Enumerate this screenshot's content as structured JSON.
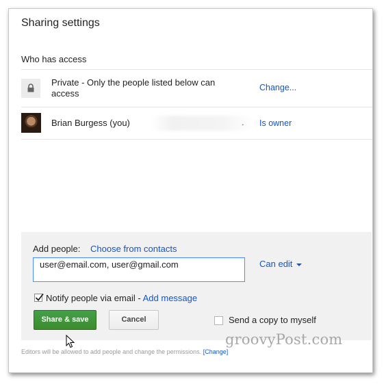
{
  "dialog": {
    "title": "Sharing settings",
    "who_has_access_label": "Who has access"
  },
  "access_rows": [
    {
      "icon": "lock-icon",
      "text": "Private - Only the people listed below can access",
      "action": "Change..."
    },
    {
      "icon": "avatar",
      "text": "Brian Burgess (you)",
      "trailing": ".",
      "action": "Is owner"
    }
  ],
  "add_people": {
    "label": "Add people:",
    "choose_link": "Choose from contacts",
    "input_value": "user@email.com, user@gmail.com",
    "permission": "Can edit",
    "notify_label": "Notify people via email - ",
    "notify_checked": true,
    "add_message_link": "Add message",
    "share_button": "Share & save",
    "cancel_button": "Cancel",
    "copy_label": "Send a copy to myself",
    "copy_checked": false
  },
  "footer": {
    "note": "Editors will be allowed to add people and change the permissions.",
    "change_link": "[Change]"
  },
  "watermark": "groovyPost.com",
  "colors": {
    "link": "#1155cc",
    "share_button": "#3d8b2e",
    "input_focus_border": "#4d90fe",
    "panel_bg": "#f1f1f1"
  }
}
